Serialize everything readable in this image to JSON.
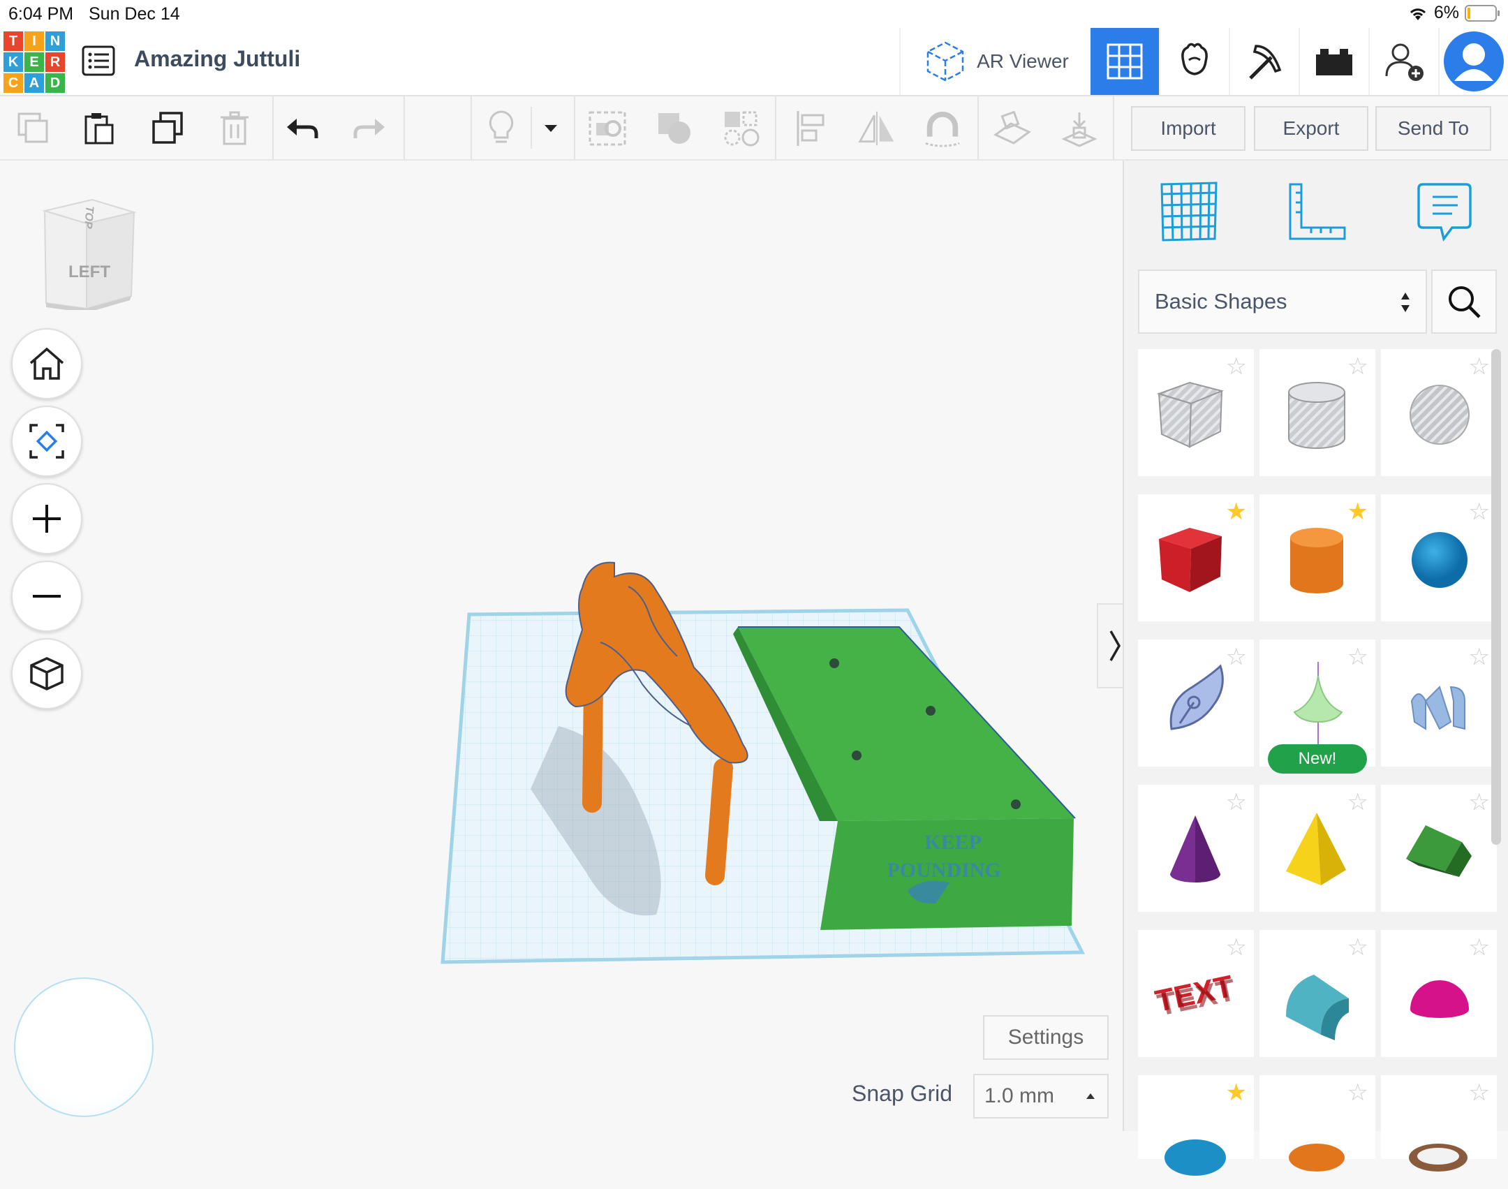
{
  "status": {
    "time": "6:04 PM",
    "date": "Sun Dec 14",
    "battery": "6%"
  },
  "logo": {
    "letters": [
      "T",
      "I",
      "N",
      "K",
      "E",
      "R",
      "C",
      "A",
      "D"
    ],
    "colors": [
      "#e8452c",
      "#f7a21b",
      "#2e9fd8",
      "#2e9fd8",
      "#3ab54a",
      "#e8452c",
      "#f7a21b",
      "#2e9fd8",
      "#3ab54a"
    ]
  },
  "header": {
    "title": "Amazing Juttuli",
    "ar_viewer": "AR Viewer"
  },
  "toolbar": {
    "import": "Import",
    "export": "Export",
    "send_to": "Send To"
  },
  "viewcube": {
    "top": "TOP",
    "left": "LEFT"
  },
  "panel": {
    "library": "Basic Shapes",
    "new_badge": "New!",
    "shapes": [
      {
        "name": "box-hole",
        "fav": false
      },
      {
        "name": "cylinder-hole",
        "fav": false
      },
      {
        "name": "sphere-hole",
        "fav": false
      },
      {
        "name": "box",
        "fav": true
      },
      {
        "name": "cylinder",
        "fav": true
      },
      {
        "name": "sphere",
        "fav": false
      },
      {
        "name": "scribble",
        "fav": false
      },
      {
        "name": "shape-generator",
        "fav": false
      },
      {
        "name": "text-wave",
        "fav": false
      },
      {
        "name": "cone",
        "fav": false
      },
      {
        "name": "pyramid",
        "fav": false
      },
      {
        "name": "roof",
        "fav": false
      },
      {
        "name": "text",
        "fav": false
      },
      {
        "name": "half-cylinder",
        "fav": false
      },
      {
        "name": "half-sphere",
        "fav": false
      },
      {
        "name": "torus",
        "fav": true
      },
      {
        "name": "tube",
        "fav": false
      },
      {
        "name": "ring",
        "fav": false
      }
    ]
  },
  "workplane": {
    "box_text_line1": "KEEP",
    "box_text_line2": "POUNDING"
  },
  "footer": {
    "settings": "Settings",
    "snap_label": "Snap Grid",
    "snap_value": "1.0 mm"
  },
  "colors": {
    "accent": "#2b7de9",
    "orange": "#e37b1e",
    "green": "#3fae49",
    "active_tab": "#2b7de9"
  }
}
